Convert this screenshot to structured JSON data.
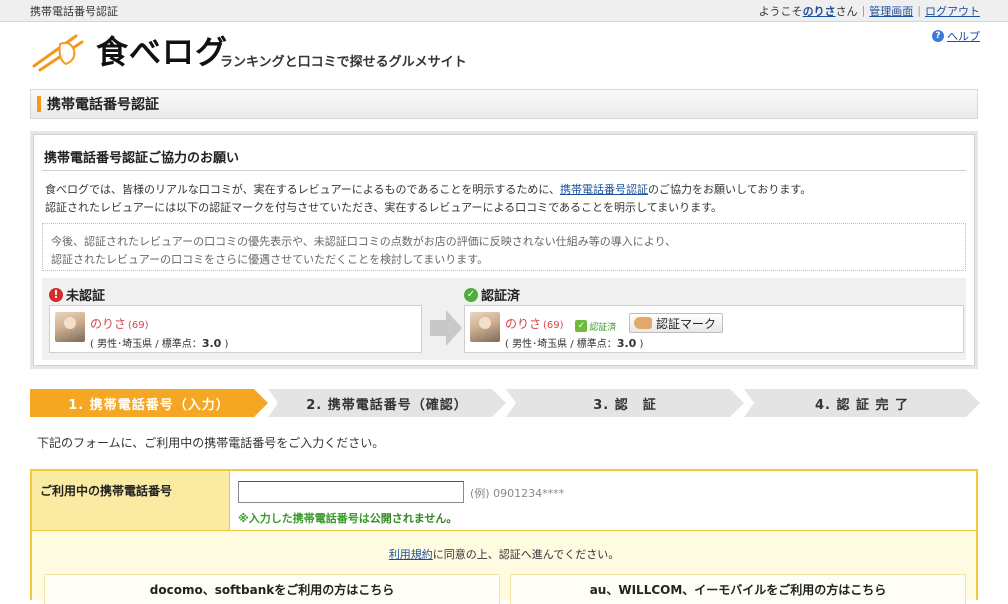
{
  "topbar": {
    "page_name": "携帯電話番号認証",
    "welcome_prefix": "ようこそ",
    "username": "のりさ",
    "welcome_suffix": "さん",
    "admin_link": "管理画面",
    "logout_link": "ログアウト"
  },
  "header": {
    "logo_text": "食べログ",
    "tagline": "ランキングと口コミで探せるグルメサイト",
    "help_link": "ヘルプ"
  },
  "page_title": "携帯電話番号認証",
  "request": {
    "title": "携帯電話番号認証ご協力のお願い",
    "line1_before": "食べログでは、皆様のリアルな口コミが、実在するレビュアーによるものであることを明示するために、",
    "line1_link": "携帯電話番号認証",
    "line1_after": "のご協力をお願いしております。",
    "line2": "認証されたレビュアーには以下の認証マークを付与させていただき、実在するレビュアーによる口コミであることを明示してまいります。",
    "note1": "今後、認証されたレビュアーの口コミの優先表示や、未認証口コミの点数がお店の評価に反映されない仕組み等の導入により、",
    "note2": "認証されたレビュアーの口コミをさらに優遇させていただくことを検討してまいります。",
    "unverified": {
      "label": "未認証",
      "name": "のりさ",
      "count": "(69)",
      "info_prefix": "( 男性･埼玉県 / 標準点：",
      "score": "3.0",
      "info_suffix": " )"
    },
    "verified": {
      "label": "認証済",
      "name": "のりさ",
      "count": "(69)",
      "badge": "認証済",
      "mark_button": "認証マーク",
      "info_prefix": "( 男性･埼玉県 / 標準点：",
      "score": "3.0",
      "info_suffix": " )"
    }
  },
  "steps": [
    {
      "label": "1. 携帯電話番号（入力）",
      "active": true
    },
    {
      "label": "2. 携帯電話番号（確認）",
      "active": false
    },
    {
      "label": "3. 認　証",
      "active": false
    },
    {
      "label": "4. 認 証 完 了",
      "active": false
    }
  ],
  "instruction": "下記のフォームに、ご利用中の携帯電話番号をご入力ください。",
  "form": {
    "phone_label": "ご利用中の携帯電話番号",
    "phone_value": "",
    "example": "(例) 0901234****",
    "privacy_before": "※入力した携帯電話番号は",
    "privacy_emph": "公開されません。",
    "agree_link": "利用規約",
    "agree_text": "に同意の上、認証へ進んでください。",
    "choice_docomo": "docomo、softbankをご利用の方はこちら",
    "choice_au": "au、WILLCOM、イーモバイルをご利用の方はこちら"
  },
  "colors": {
    "accent_orange": "#f39a1e",
    "step_active": "#f5a623",
    "step_inactive": "#e4e4e4",
    "form_border": "#f1c93d",
    "link": "#1a4f9c"
  }
}
